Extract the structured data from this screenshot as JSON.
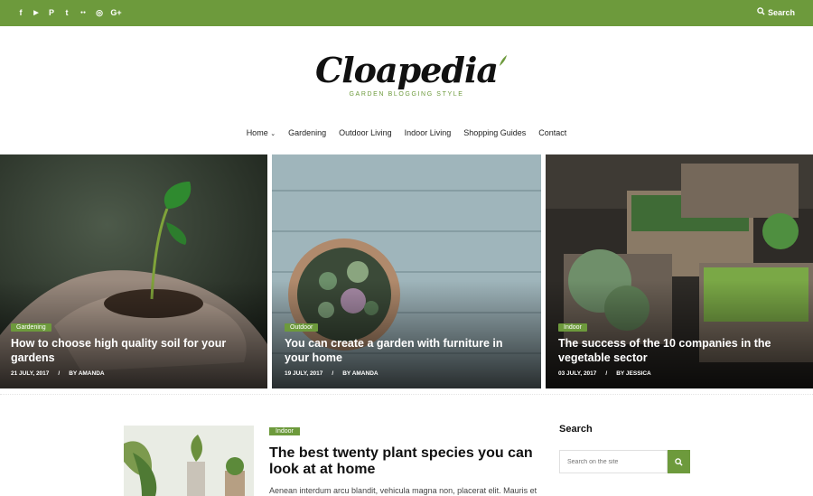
{
  "topbar": {
    "social_icons": [
      {
        "name": "facebook-icon",
        "glyph": "f"
      },
      {
        "name": "youtube-icon",
        "glyph": "▶"
      },
      {
        "name": "pinterest-icon",
        "glyph": "P"
      },
      {
        "name": "twitter-icon",
        "glyph": "t"
      },
      {
        "name": "flickr-icon",
        "glyph": "●●"
      },
      {
        "name": "instagram-icon",
        "glyph": "◎"
      },
      {
        "name": "googleplus-icon",
        "glyph": "G+"
      }
    ],
    "search_label": "Search"
  },
  "brand": {
    "name": "Cloapedia",
    "tagline": "GARDEN BLOGGING STYLE",
    "accent_color": "#6d9a3c"
  },
  "nav": {
    "items": [
      "Home",
      "Gardening",
      "Outdoor Living",
      "Indoor Living",
      "Shopping Guides",
      "Contact"
    ]
  },
  "featured": [
    {
      "category": "Gardening",
      "title": "How to choose high quality soil for your gardens",
      "date": "21 JULY, 2017",
      "author": "BY AMANDA"
    },
    {
      "category": "Outdoor",
      "title": "You can create a garden with furniture in your home",
      "date": "19 JULY, 2017",
      "author": "BY AMANDA"
    },
    {
      "category": "Indoor",
      "title": "The success of the 10 companies in the vegetable sector",
      "date": "03 JULY, 2017",
      "author": "BY JESSICA"
    }
  ],
  "post": {
    "category": "Indoor",
    "title": "The best twenty plant species you can look at at home",
    "excerpt": "Aenean interdum arcu blandit, vehicula magna non, placerat elit. Mauris et"
  },
  "sidebar": {
    "search_heading": "Search",
    "search_placeholder": "Search on the site"
  }
}
